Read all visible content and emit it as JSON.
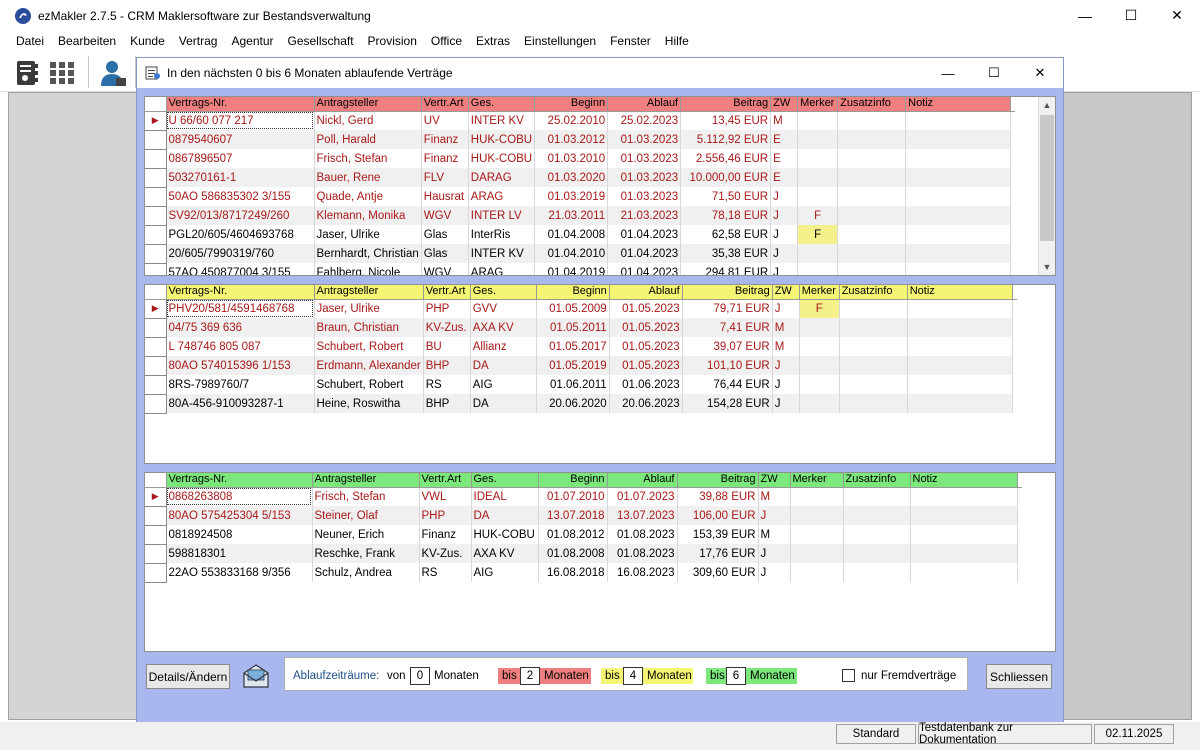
{
  "app": {
    "title": "ezMakler 2.7.5  -  CRM Maklersoftware zur Bestandsverwaltung",
    "minimize": "—",
    "maximize": "☐",
    "close": "✕"
  },
  "menu": [
    "Datei",
    "Bearbeiten",
    "Kunde",
    "Vertrag",
    "Agentur",
    "Gesellschaft",
    "Provision",
    "Office",
    "Extras",
    "Einstellungen",
    "Fenster",
    "Hilfe"
  ],
  "child": {
    "title": "In den nächsten 0 bis 6 Monaten ablaufende Verträge",
    "minimize": "—",
    "maximize": "☐",
    "close": "✕"
  },
  "columns": [
    "Vertrags-Nr.",
    "Antragsteller",
    "Vertr.Art",
    "Ges.",
    "Beginn",
    "Ablauf",
    "Beitrag",
    "ZW",
    "Merker",
    "Zusatzinfo",
    "Notiz"
  ],
  "grid_red": {
    "rows": [
      [
        "U 66/60 077 217",
        "Nickl, Gerd",
        "UV",
        "INTER KV",
        "25.02.2010",
        "25.02.2023",
        "13,45 EUR",
        "M",
        "",
        "",
        ""
      ],
      [
        "0879540607",
        "Poll, Harald",
        "Finanz",
        "HUK-COBU",
        "01.03.2012",
        "01.03.2023",
        "5.112,92 EUR",
        "E",
        "",
        "",
        ""
      ],
      [
        "0867896507",
        "Frisch, Stefan",
        "Finanz",
        "HUK-COBU",
        "01.03.2010",
        "01.03.2023",
        "2.556,46 EUR",
        "E",
        "",
        "",
        ""
      ],
      [
        "503270161-1",
        "Bauer, Rene",
        "FLV",
        "DARAG",
        "01.03.2020",
        "01.03.2023",
        "10.000,00 EUR",
        "E",
        "",
        "",
        ""
      ],
      [
        "50AO 586835302 3/155",
        "Quade, Antje",
        "Hausrat",
        "ARAG",
        "01.03.2019",
        "01.03.2023",
        "71,50 EUR",
        "J",
        "",
        "",
        ""
      ],
      [
        "SV92/013/8717249/260",
        "Klemann, Monika",
        "WGV",
        "INTER LV",
        "21.03.2011",
        "21.03.2023",
        "78,18 EUR",
        "J",
        "F",
        "",
        ""
      ],
      [
        "PGL20/605/4604693768",
        "Jaser, Ulrike",
        "Glas",
        "InterRis",
        "01.04.2008",
        "01.04.2023",
        "62,58 EUR",
        "J",
        "F",
        "",
        ""
      ],
      [
        "20/605/7990319/760",
        "Bernhardt, Christian",
        "Glas",
        "INTER KV",
        "01.04.2010",
        "01.04.2023",
        "35,38 EUR",
        "J",
        "",
        "",
        ""
      ],
      [
        "57AO 450877004 3/155",
        "Fahlberg, Nicole",
        "WGV",
        "ARAG",
        "01.04.2019",
        "01.04.2023",
        "294,81 EUR",
        "J",
        "",
        "",
        ""
      ]
    ],
    "red_rows": [
      0,
      1,
      2,
      3,
      4,
      5
    ]
  },
  "grid_yellow": {
    "rows": [
      [
        "PHV20/581/4591468768",
        "Jaser, Ulrike",
        "PHP",
        "GVV",
        "01.05.2009",
        "01.05.2023",
        "79,71 EUR",
        "J",
        "F",
        "",
        ""
      ],
      [
        "04/75 369 636",
        "Braun, Christian",
        "KV-Zus.",
        "AXA KV",
        "01.05.2011",
        "01.05.2023",
        "7,41 EUR",
        "M",
        "",
        "",
        ""
      ],
      [
        "L 748746 805 087",
        "Schubert, Robert",
        "BU",
        "Allianz",
        "01.05.2017",
        "01.05.2023",
        "39,07 EUR",
        "M",
        "",
        "",
        ""
      ],
      [
        "80AO 574015396 1/153",
        "Erdmann, Alexander",
        "BHP",
        "DA",
        "01.05.2019",
        "01.05.2023",
        "101,10 EUR",
        "J",
        "",
        "",
        ""
      ],
      [
        "8RS-7989760/7",
        "Schubert, Robert",
        "RS",
        "AIG",
        "01.06.2011",
        "01.06.2023",
        "76,44 EUR",
        "J",
        "",
        "",
        ""
      ],
      [
        "80A-456-910093287-1",
        "Heine, Roswitha",
        "BHP",
        "DA",
        "20.06.2020",
        "20.06.2023",
        "154,28 EUR",
        "J",
        "",
        "",
        ""
      ]
    ],
    "red_rows": [
      0,
      1,
      2,
      3
    ]
  },
  "grid_green": {
    "rows": [
      [
        "0868263808",
        "Frisch, Stefan",
        "VWL",
        "IDEAL",
        "01.07.2010",
        "01.07.2023",
        "39,88 EUR",
        "M",
        "",
        "",
        ""
      ],
      [
        "80AO 575425304 5/153",
        "Steiner, Olaf",
        "PHP",
        "DA",
        "13.07.2018",
        "13.07.2023",
        "106,00 EUR",
        "J",
        "",
        "",
        ""
      ],
      [
        "0818924508",
        "Neuner, Erich",
        "Finanz",
        "HUK-COBU",
        "01.08.2012",
        "01.08.2023",
        "153,39 EUR",
        "M",
        "",
        "",
        ""
      ],
      [
        "598818301",
        "Reschke, Frank",
        "KV-Zus.",
        "AXA KV",
        "01.08.2008",
        "01.08.2023",
        "17,76 EUR",
        "J",
        "",
        "",
        ""
      ],
      [
        "22AO 553833168 9/356",
        "Schulz, Andrea",
        "RS",
        "AIG",
        "16.08.2018",
        "16.08.2023",
        "309,60 EUR",
        "J",
        "",
        "",
        ""
      ]
    ],
    "red_rows": [
      0,
      1
    ]
  },
  "controls": {
    "details_button": "Details/Ändern",
    "range_label": "Ablaufzeiträume:",
    "von": "von",
    "von_value": "0",
    "monaten": "Monaten",
    "bis": "bis",
    "bis1_value": "2",
    "bis2_value": "4",
    "bis3_value": "6",
    "fremd_label": "nur Fremdverträge",
    "close_button": "Schliessen"
  },
  "statusbar": {
    "mode": "Standard",
    "database": "Testdatenbank zur Dokumentation",
    "date": "02.11.2025"
  },
  "colors": {
    "red_band": "#f08080",
    "yellow_band": "#f5f574",
    "green_band": "#7ce87c",
    "red_text": "#a81818",
    "merker": "#f4f08c"
  }
}
